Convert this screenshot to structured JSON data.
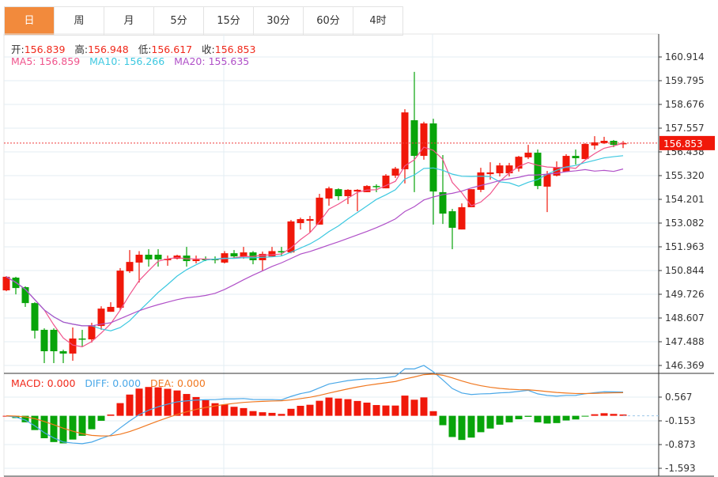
{
  "tabs": [
    "日",
    "周",
    "月",
    "5分",
    "15分",
    "30分",
    "60分",
    "4时"
  ],
  "active_tab": 0,
  "ohlc_info": {
    "open_label": "开:",
    "open": "156.839",
    "high_label": "高:",
    "high": "156.948",
    "low_label": "低:",
    "low": "156.617",
    "close_label": "收:",
    "close": "156.853"
  },
  "ma_info": {
    "ma5": "MA5: 156.859",
    "ma10": "MA10: 156.266",
    "ma20": "MA20: 155.635"
  },
  "macd_info": {
    "macd": "MACD: 0.000",
    "diff": "DIFF: 0.000",
    "dea": "DEA: 0.000"
  },
  "colors": {
    "up": "#f0180a",
    "down": "#08a40a",
    "ma5": "#f0548c",
    "ma10": "#3cc8e0",
    "ma20": "#b050c8",
    "diff": "#4aa8e8",
    "dea": "#f07820",
    "tab_active": "#f28a3c"
  },
  "chart_data": {
    "type": "candlestick",
    "price_ticks": [
      "160.914",
      "159.795",
      "158.676",
      "157.557",
      "156.438",
      "155.320",
      "154.201",
      "153.082",
      "151.963",
      "150.844",
      "149.726",
      "148.607",
      "147.488",
      "146.369"
    ],
    "price_range": [
      146.369,
      160.914
    ],
    "last_price": "156.853",
    "macd_ticks": [
      "0.567",
      "-0.153",
      "-0.873",
      "-1.593"
    ],
    "macd_range": [
      -1.593,
      0.567
    ],
    "candles": [
      [
        149.91,
        150.58,
        149.87,
        150.55
      ],
      [
        150.51,
        150.55,
        149.72,
        150.02
      ],
      [
        150.06,
        150.1,
        149.13,
        149.31
      ],
      [
        149.31,
        149.35,
        147.64,
        148.01
      ],
      [
        148.05,
        148.12,
        146.48,
        147.04
      ],
      [
        148.05,
        148.12,
        146.48,
        147.04
      ],
      [
        147.04,
        147.11,
        146.48,
        146.93
      ],
      [
        146.93,
        148.16,
        146.59,
        147.64
      ],
      [
        147.64,
        148.05,
        147.26,
        147.6
      ],
      [
        147.6,
        148.38,
        147.45,
        148.27
      ],
      [
        148.23,
        149.16,
        148.05,
        149.05
      ],
      [
        148.9,
        149.35,
        148.9,
        149.13
      ],
      [
        149.09,
        150.96,
        148.98,
        150.84
      ],
      [
        150.81,
        151.81,
        150.73,
        151.25
      ],
      [
        151.22,
        151.76,
        150.28,
        151.59
      ],
      [
        151.59,
        151.85,
        151.03,
        151.37
      ],
      [
        151.59,
        151.85,
        151.03,
        151.37
      ],
      [
        151.33,
        151.55,
        151.07,
        151.4
      ],
      [
        151.4,
        151.59,
        151.37,
        151.55
      ],
      [
        151.55,
        151.96,
        151.03,
        151.29
      ],
      [
        151.29,
        151.55,
        151.18,
        151.37
      ],
      [
        151.4,
        151.51,
        151.29,
        151.33
      ],
      [
        151.4,
        151.51,
        151.18,
        151.33
      ],
      [
        151.22,
        151.76,
        151.18,
        151.66
      ],
      [
        151.66,
        151.81,
        151.44,
        151.51
      ],
      [
        151.51,
        151.96,
        151.4,
        151.7
      ],
      [
        151.7,
        151.76,
        151.14,
        151.33
      ],
      [
        151.33,
        151.74,
        150.84,
        151.63
      ],
      [
        151.51,
        151.96,
        151.51,
        151.76
      ],
      [
        151.76,
        151.96,
        151.55,
        151.7
      ],
      [
        151.7,
        153.23,
        151.66,
        153.16
      ],
      [
        153.08,
        153.34,
        152.78,
        153.27
      ],
      [
        153.19,
        153.42,
        152.63,
        153.27
      ],
      [
        153.01,
        154.46,
        153.01,
        154.28
      ],
      [
        154.24,
        154.8,
        153.9,
        154.72
      ],
      [
        154.68,
        154.72,
        154.16,
        154.35
      ],
      [
        154.35,
        154.68,
        153.98,
        154.65
      ],
      [
        154.57,
        154.68,
        153.64,
        154.65
      ],
      [
        154.54,
        154.87,
        154.54,
        154.83
      ],
      [
        154.83,
        154.91,
        154.54,
        154.8
      ],
      [
        154.72,
        155.39,
        154.72,
        155.32
      ],
      [
        155.32,
        155.73,
        155.21,
        155.65
      ],
      [
        155.62,
        158.45,
        154.95,
        158.3
      ],
      [
        157.93,
        160.21,
        154.54,
        156.25
      ],
      [
        156.25,
        157.86,
        156.07,
        157.78
      ],
      [
        157.78,
        158.0,
        153.01,
        154.57
      ],
      [
        154.54,
        156.29,
        153.04,
        153.53
      ],
      [
        153.64,
        153.75,
        151.85,
        152.86
      ],
      [
        152.78,
        154.01,
        152.78,
        153.83
      ],
      [
        153.83,
        154.68,
        153.83,
        154.68
      ],
      [
        154.65,
        155.69,
        154.54,
        155.47
      ],
      [
        155.39,
        155.95,
        155.13,
        155.47
      ],
      [
        155.43,
        155.92,
        155.28,
        155.8
      ],
      [
        155.43,
        155.92,
        155.28,
        155.8
      ],
      [
        155.65,
        156.25,
        155.51,
        156.21
      ],
      [
        156.18,
        156.77,
        156.1,
        156.4
      ],
      [
        156.4,
        156.55,
        154.68,
        154.83
      ],
      [
        154.8,
        155.54,
        153.6,
        155.39
      ],
      [
        155.32,
        155.99,
        155.28,
        155.69
      ],
      [
        155.51,
        156.33,
        155.51,
        156.25
      ],
      [
        156.25,
        156.55,
        155.84,
        156.14
      ],
      [
        156.1,
        156.85,
        156.1,
        156.81
      ],
      [
        156.74,
        157.18,
        156.55,
        156.89
      ],
      [
        156.85,
        157.15,
        156.81,
        156.96
      ],
      [
        156.96,
        157.0,
        156.66,
        156.77
      ],
      [
        156.839,
        156.948,
        156.617,
        156.853
      ]
    ]
  }
}
